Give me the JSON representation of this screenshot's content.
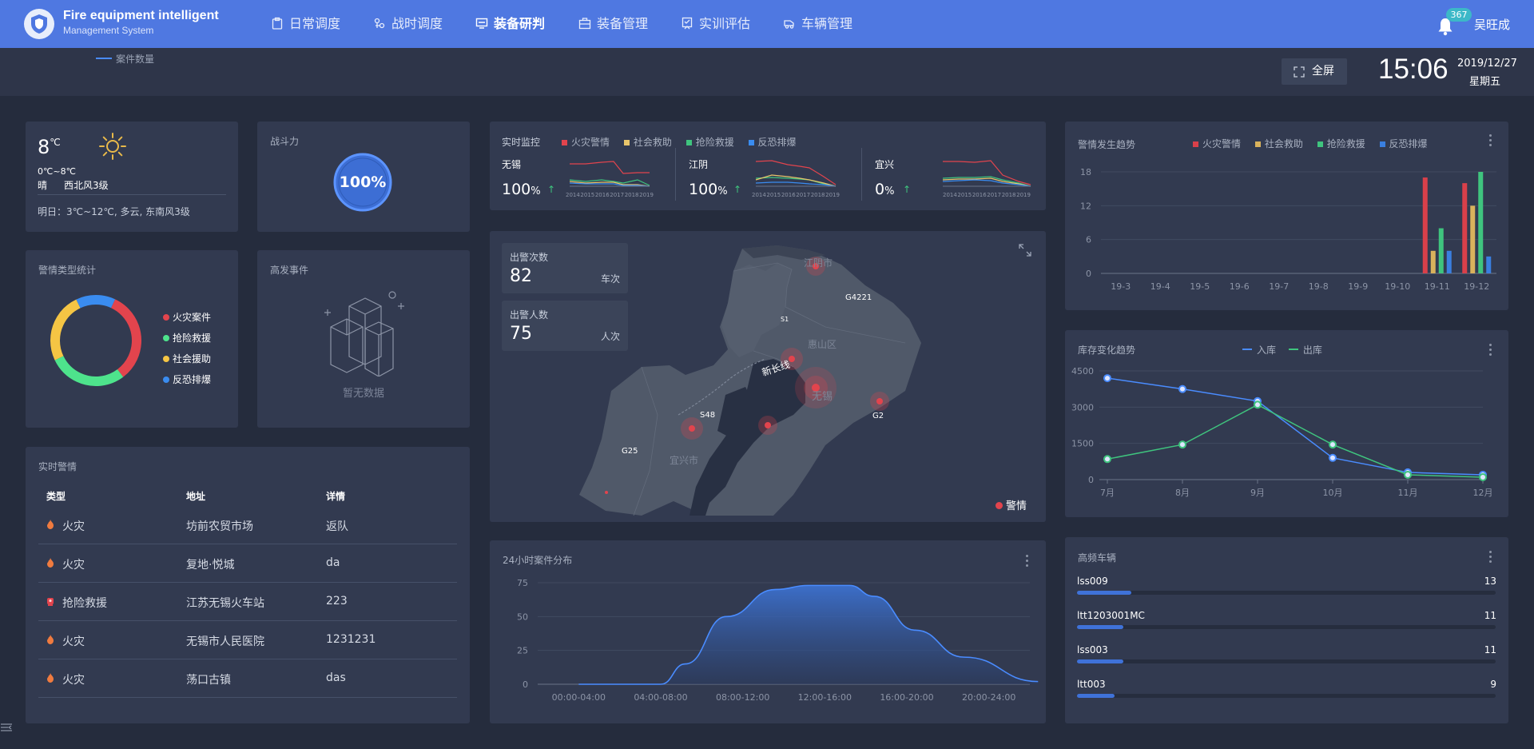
{
  "header": {
    "title": "Fire equipment intelligent",
    "subtitle": "Management System",
    "nav": [
      {
        "label": "日常调度",
        "active": false
      },
      {
        "label": "战时调度",
        "active": false
      },
      {
        "label": "装备研判",
        "active": true
      },
      {
        "label": "装备管理",
        "active": false
      },
      {
        "label": "实训评估",
        "active": false
      },
      {
        "label": "车辆管理",
        "active": false
      }
    ],
    "notification_count": "367",
    "username": "吴旺成"
  },
  "subbar": {
    "legend_label": "案件数量",
    "fullscreen_label": "全屏",
    "time": "15:06",
    "date": "2019/12/27",
    "weekday": "星期五"
  },
  "weather": {
    "temp": "8",
    "temp_unit": "℃",
    "range": "0℃~8℃",
    "condition": "晴",
    "wind": "西北风3级",
    "tomorrow": "明日：3℃~12℃, 多云, 东南风3级"
  },
  "power": {
    "title": "战斗力",
    "value": "100%"
  },
  "types": {
    "title": "警情类型统计",
    "legend": [
      {
        "label": "火灾案件",
        "color": "#e2444d"
      },
      {
        "label": "抢险救援",
        "color": "#4ee38c"
      },
      {
        "label": "社会援助",
        "color": "#f5c544"
      },
      {
        "label": "反恐排爆",
        "color": "#3a8cf0"
      }
    ]
  },
  "events": {
    "title": "高发事件",
    "empty": "暂无数据"
  },
  "alerts": {
    "title": "实时警情",
    "headers": [
      "类型",
      "地址",
      "详情"
    ],
    "rows": [
      {
        "type": "火灾",
        "address": "坊前农贸市场",
        "detail": "返队",
        "icon": "flame-icon"
      },
      {
        "type": "火灾",
        "address": "复地·悦城",
        "detail": "da",
        "icon": "flame-icon"
      },
      {
        "type": "抢险救援",
        "address": "江苏无锡火车站",
        "detail": "223",
        "icon": "rescue-icon"
      },
      {
        "type": "火灾",
        "address": "无锡市人民医院",
        "detail": "1231231",
        "icon": "flame-icon"
      },
      {
        "type": "火灾",
        "address": "荡口古镇",
        "detail": "das",
        "icon": "flame-icon"
      }
    ]
  },
  "monitor": {
    "title": "实时监控",
    "legend": [
      {
        "label": "火灾警情",
        "color": "#e2444d"
      },
      {
        "label": "社会救助",
        "color": "#e8c56b"
      },
      {
        "label": "抢险救援",
        "color": "#3fc47e"
      },
      {
        "label": "反恐排爆",
        "color": "#3a8cf0"
      }
    ],
    "cities": [
      {
        "name": "无锡",
        "value": "100",
        "unit": "%"
      },
      {
        "name": "江阴",
        "value": "100",
        "unit": "%"
      },
      {
        "name": "宜兴",
        "value": "0",
        "unit": "%"
      }
    ],
    "years": [
      "2014",
      "2015",
      "2016",
      "2017",
      "2018",
      "2019"
    ]
  },
  "map": {
    "dispatch_label": "出警次数",
    "dispatch_value": "82",
    "dispatch_unit": "车次",
    "people_label": "出警人数",
    "people_value": "75",
    "people_unit": "人次",
    "labels": [
      "江阴市",
      "G4221",
      "惠山区",
      "新长线",
      "无锡",
      "S48",
      "G25",
      "宜兴市",
      "G2",
      "S1"
    ],
    "legend": "警情"
  },
  "hourly": {
    "title": "24小时案件分布",
    "chart_data": {
      "type": "area",
      "categories": [
        "00:00-04:00",
        "04:00-08:00",
        "08:00-12:00",
        "12:00-16:00",
        "16:00-20:00",
        "20:00-24:00"
      ],
      "ylim": [
        0,
        75
      ],
      "yticks": [
        0,
        25,
        50,
        75
      ],
      "points": [
        [
          0,
          0
        ],
        [
          1,
          0
        ],
        [
          1.3,
          15
        ],
        [
          1.8,
          50
        ],
        [
          2.4,
          70
        ],
        [
          2.8,
          73
        ],
        [
          3.3,
          73
        ],
        [
          3.6,
          65
        ],
        [
          4.1,
          40
        ],
        [
          4.7,
          20
        ],
        [
          5.6,
          2
        ]
      ]
    }
  },
  "trend": {
    "title": "警情发生趋势",
    "chart_data": {
      "type": "bar",
      "categories": [
        "19-3",
        "19-4",
        "19-5",
        "19-6",
        "19-7",
        "19-8",
        "19-9",
        "19-10",
        "19-11",
        "19-12"
      ],
      "ylim": [
        0,
        18
      ],
      "yticks": [
        0,
        6,
        12,
        18
      ],
      "series": [
        {
          "name": "火灾警情",
          "color": "#d9404a",
          "values": [
            0,
            0,
            0,
            0,
            0,
            0,
            0,
            0,
            17,
            16
          ]
        },
        {
          "name": "社会救助",
          "color": "#d9b25c",
          "values": [
            0,
            0,
            0,
            0,
            0,
            0,
            0,
            0,
            4,
            12
          ]
        },
        {
          "name": "抢险救援",
          "color": "#3fc47e",
          "values": [
            0,
            0,
            0,
            0,
            0,
            0,
            0,
            0,
            8,
            18
          ]
        },
        {
          "name": "反恐排爆",
          "color": "#3a7fe0",
          "values": [
            0,
            0,
            0,
            0,
            0,
            0,
            0,
            0,
            4,
            3
          ]
        }
      ]
    }
  },
  "stock": {
    "title": "库存变化趋势",
    "chart_data": {
      "type": "line",
      "categories": [
        "7月",
        "8月",
        "9月",
        "10月",
        "11月",
        "12月"
      ],
      "ylim": [
        0,
        4500
      ],
      "yticks": [
        0,
        1500,
        3000,
        4500
      ],
      "series": [
        {
          "name": "入库",
          "color": "#4a8cff",
          "values": [
            4200,
            3750,
            3250,
            900,
            300,
            200
          ]
        },
        {
          "name": "出库",
          "color": "#3fc47e",
          "values": [
            850,
            1450,
            3100,
            1450,
            200,
            100
          ]
        }
      ]
    }
  },
  "vehicles": {
    "title": "高频车辆",
    "items": [
      {
        "name": "lss009",
        "value": 13
      },
      {
        "name": "ltt1203001MC",
        "value": 11
      },
      {
        "name": "lss003",
        "value": 11
      },
      {
        "name": "ltt003",
        "value": 9
      }
    ]
  }
}
